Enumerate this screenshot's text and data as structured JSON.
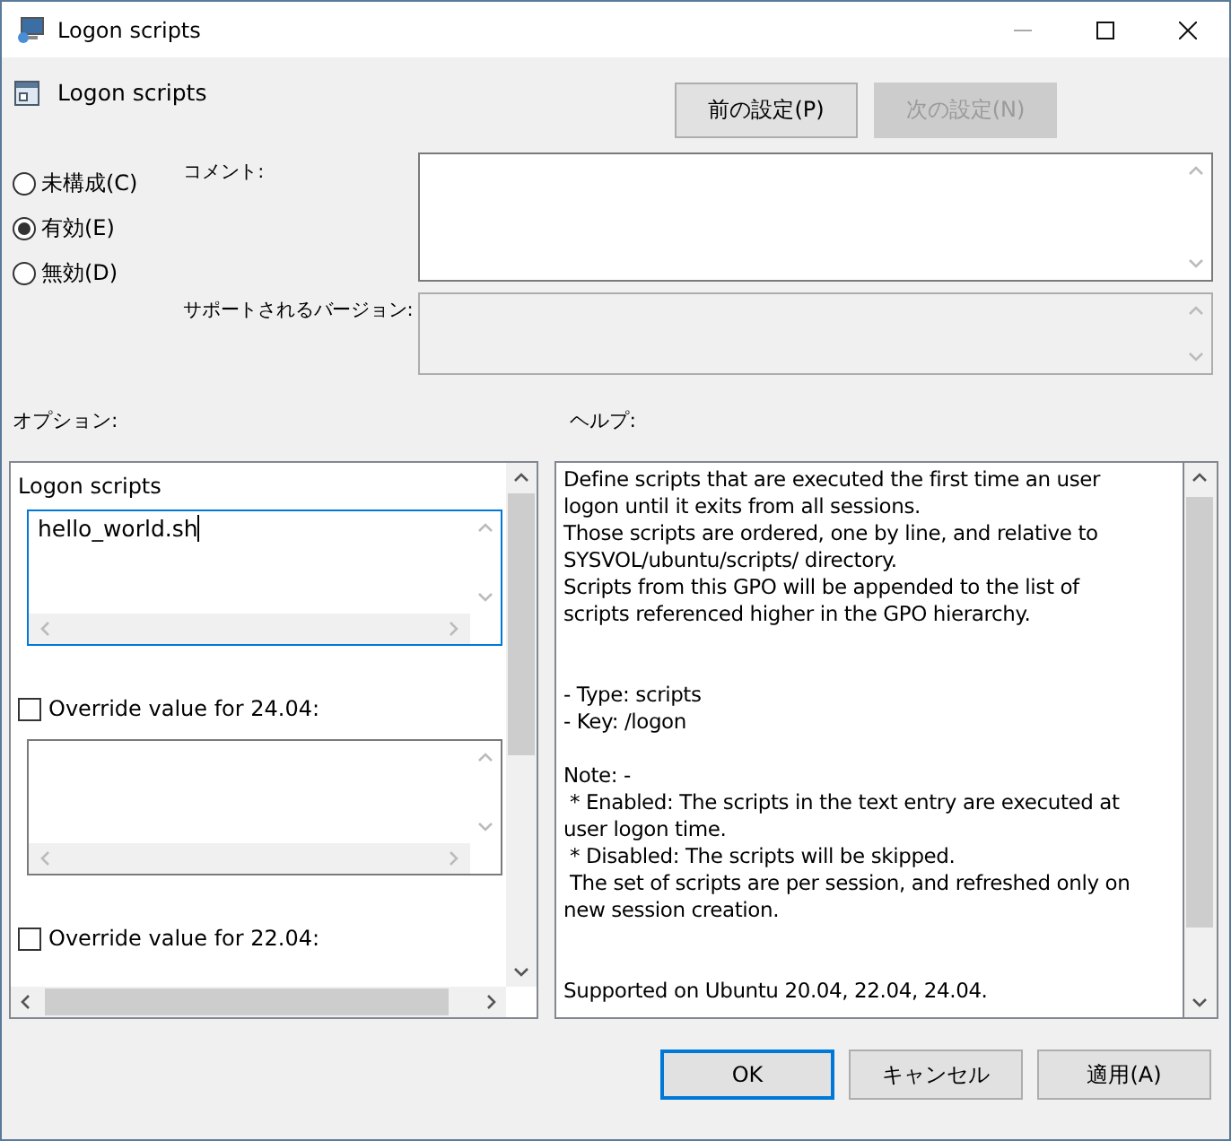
{
  "window": {
    "title": "Logon scripts"
  },
  "header": {
    "title": "Logon scripts"
  },
  "nav_buttons": [
    {
      "label": "前の設定(P)",
      "disabled": false
    },
    {
      "label": "次の設定(N)",
      "disabled": true
    }
  ],
  "state_options": [
    {
      "label": "未構成(C)",
      "selected": false
    },
    {
      "label": "有効(E)",
      "selected": true
    },
    {
      "label": "無効(D)",
      "selected": false
    }
  ],
  "comment": {
    "label": "コメント:"
  },
  "supported": {
    "label": "サポートされるバージョン:"
  },
  "options": {
    "heading": "オプション:",
    "items": [
      {
        "kind": "title",
        "text": "Logon scripts"
      },
      {
        "kind": "field",
        "value": "hello_world.sh",
        "focused": true
      },
      {
        "kind": "checkbox",
        "label": "Override value for 24.04:",
        "checked": false
      },
      {
        "kind": "field",
        "focused": false
      },
      {
        "kind": "checkbox",
        "label": "Override value for 22.04:",
        "checked": false
      }
    ]
  },
  "help": {
    "heading": "ヘルプ:",
    "blocks": [
      {
        "lines": [
          "Define scripts that are executed the first time an user",
          "logon until it exits from all sessions.",
          "Those scripts are ordered, one by line, and relative to",
          "SYSVOL/ubuntu/scripts/ directory.",
          "Scripts from this GPO will be appended to the list of",
          "scripts referenced higher in the GPO hierarchy."
        ]
      },
      {
        "lines": [
          "- Type: scripts",
          "- Key: /logon"
        ]
      },
      {
        "lines": [
          "Note: -",
          " * Enabled: The scripts in the text entry are executed at",
          "user logon time.",
          " * Disabled: The scripts will be skipped.",
          " The set of scripts are per session, and refreshed only on",
          "new session creation."
        ]
      },
      {
        "lines": [
          "Supported on Ubuntu 20.04, 22.04, 24.04."
        ]
      }
    ]
  },
  "buttons": [
    {
      "label": "OK",
      "default": true
    },
    {
      "label": "キャンセル",
      "default": false
    },
    {
      "label": "適用(A)",
      "default": false
    }
  ]
}
